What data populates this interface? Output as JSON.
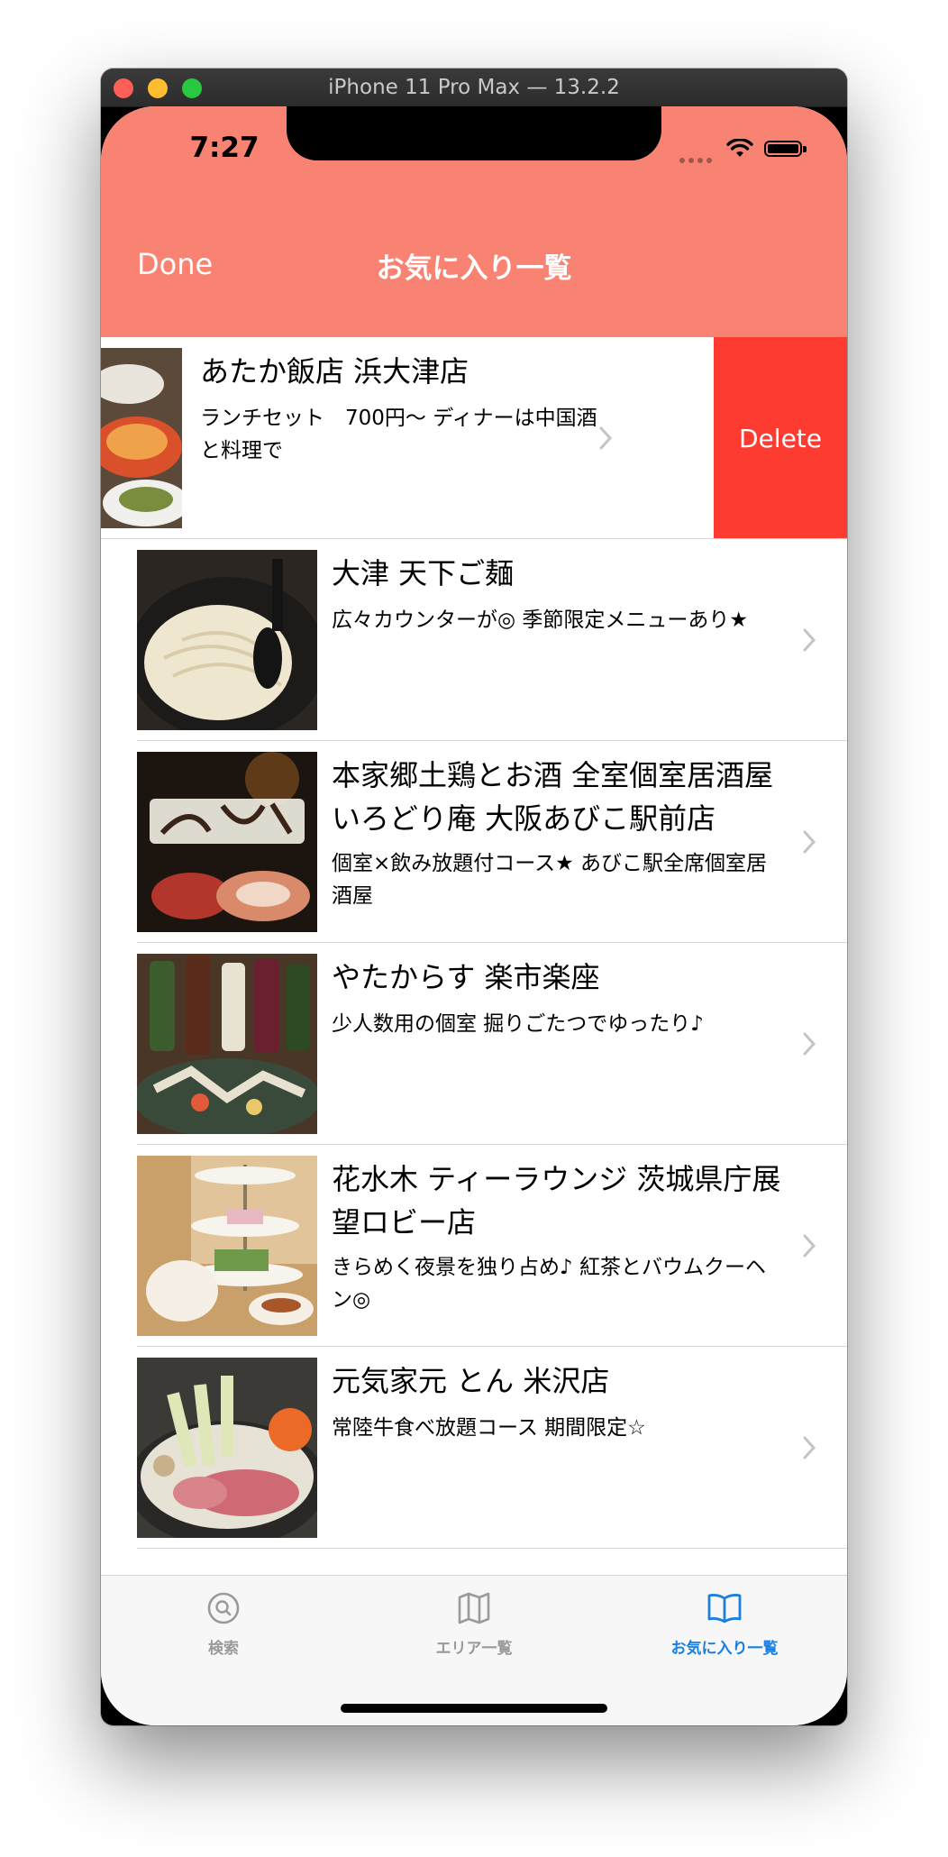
{
  "window": {
    "title": "iPhone 11 Pro Max — 13.2.2"
  },
  "status_bar": {
    "time": "7:27"
  },
  "nav": {
    "left_button": "Done",
    "title": "お気に入り一覧"
  },
  "rows": [
    {
      "title": "あたか飯店 浜大津店",
      "subtitle": "ランチセット　700円〜 ディナーは中国酒と料理で",
      "delete_label": "Delete"
    },
    {
      "title": "大津 天下ご麺",
      "subtitle": "広々カウンターが◎ 季節限定メニューあり★"
    },
    {
      "title": "本家郷土鶏とお酒 全室個室居酒屋 いろどり庵 大阪あびこ駅前店",
      "subtitle": "個室×飲み放題付コース★ あびこ駅全席個室居酒屋"
    },
    {
      "title": "やたからす 楽市楽座",
      "subtitle": "少人数用の個室 掘りごたつでゆったり♪"
    },
    {
      "title": "花水木 ティーラウンジ 茨城県庁展望ロビー店",
      "subtitle": "きらめく夜景を独り占め♪ 紅茶とバウムクーヘン◎"
    },
    {
      "title": "元気家元 とん 米沢店",
      "subtitle": "常陸牛食べ放題コース 期間限定☆"
    }
  ],
  "tabs": [
    {
      "label": "検索",
      "icon": "search-icon",
      "active": false
    },
    {
      "label": "エリア一覧",
      "icon": "map-icon",
      "active": false
    },
    {
      "label": "お気に入り一覧",
      "icon": "book-icon",
      "active": true
    }
  ],
  "colors": {
    "nav_bar": "#f98373",
    "delete": "#fe3b30",
    "tab_active": "#1a7fe0",
    "tab_inactive": "#9a9a9a"
  }
}
